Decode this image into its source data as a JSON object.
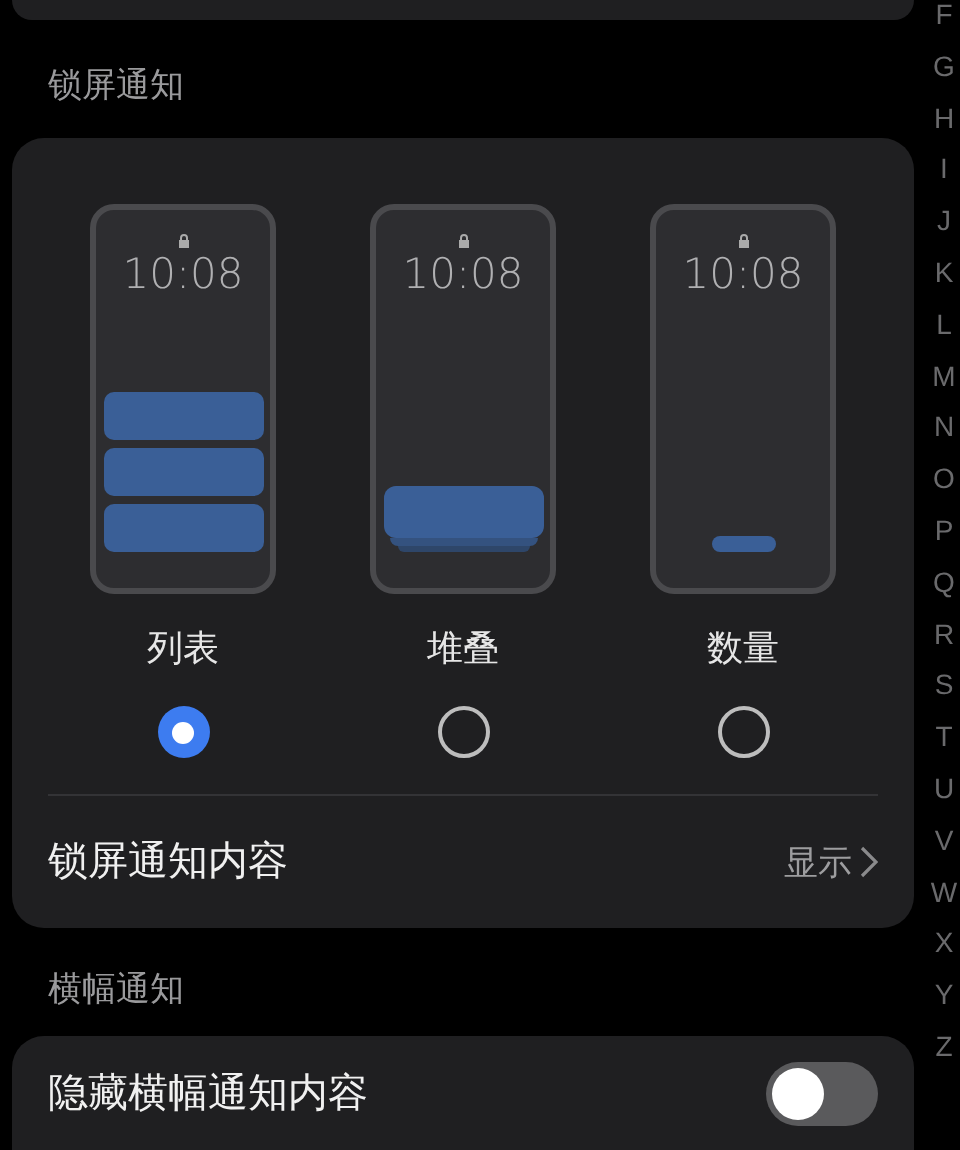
{
  "lock_screen_section": {
    "title": "锁屏通知",
    "styles": [
      {
        "kind": "list",
        "time": "10:08",
        "label": "列表",
        "selected": true
      },
      {
        "kind": "stack",
        "time": "10:08",
        "label": "堆叠",
        "selected": false
      },
      {
        "kind": "count",
        "time": "10:08",
        "label": "数量",
        "selected": false
      }
    ],
    "content_row": {
      "label": "锁屏通知内容",
      "value": "显示"
    }
  },
  "banner_section": {
    "title": "横幅通知",
    "hide_content": {
      "label": "隐藏横幅通知内容",
      "on": false
    }
  },
  "index_letters": [
    "F",
    "G",
    "H",
    "I",
    "J",
    "K",
    "L",
    "M",
    "N",
    "O",
    "P",
    "Q",
    "R",
    "S",
    "T",
    "U",
    "V",
    "W",
    "X",
    "Y",
    "Z"
  ]
}
